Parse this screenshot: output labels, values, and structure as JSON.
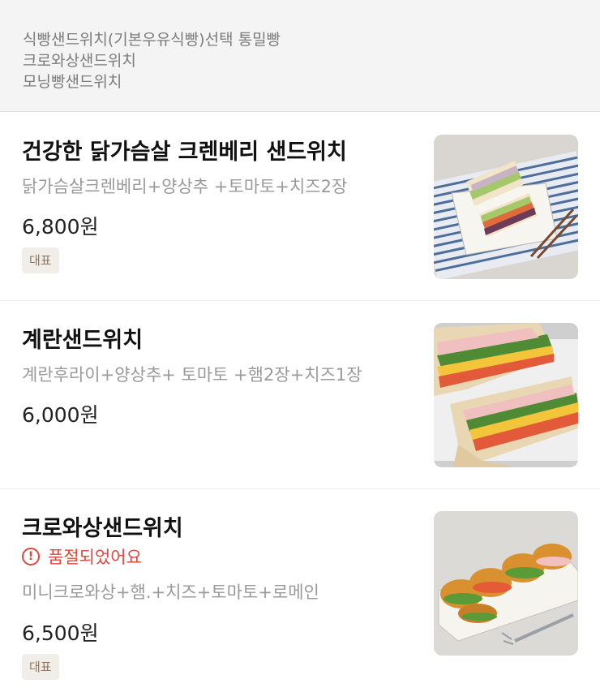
{
  "notice": {
    "lines": [
      "식빵샌드위치(기본우유식빵)선택 통밀빵",
      "크로와상샌드위치",
      "모닝빵샌드위치"
    ]
  },
  "menu": [
    {
      "name": "건강한 닭가슴살 크렌베리 샌드위치",
      "description": "닭가슴살크렌베리+양상추 +토마토+치즈2장",
      "price": "6,800원",
      "badge": "대표",
      "image_icon": "cranberry-chicken-sandwich-photo"
    },
    {
      "name": "계란샌드위치",
      "description": "계란후라이+양상추+ 토마토 +햄2장+치즈1장",
      "price": "6,000원",
      "image_icon": "egg-sandwich-photo"
    },
    {
      "name": "크로와상샌드위치",
      "status": "품절되었어요",
      "status_icon": "alert-circle-icon",
      "status_color": "#e2473e",
      "description": "미니크로와상+햄.+치즈+토마토+로메인",
      "price": "6,500원",
      "badge": "대표",
      "image_icon": "croissant-sandwich-photo"
    }
  ]
}
